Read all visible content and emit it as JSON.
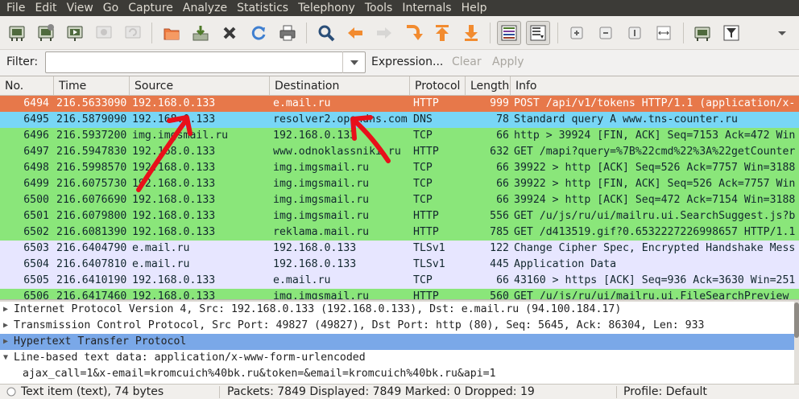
{
  "menu": [
    "File",
    "Edit",
    "View",
    "Go",
    "Capture",
    "Analyze",
    "Statistics",
    "Telephony",
    "Tools",
    "Internals",
    "Help"
  ],
  "toolbar": {
    "icons": [
      "interfaces-icon",
      "options-icon",
      "start-capture-icon",
      "stop-capture-icon",
      "restart-capture-icon",
      "open-file-icon",
      "save-file-icon",
      "close-file-icon",
      "reload-icon",
      "print-icon",
      "find-icon",
      "go-back-icon",
      "go-forward-icon",
      "go-to-packet-icon",
      "go-first-icon",
      "go-last-icon",
      "colorize-icon",
      "autoscroll-icon",
      "zoom-in-icon",
      "zoom-out-icon",
      "normal-size-icon",
      "resize-columns-icon",
      "capture-filters-icon",
      "display-filters-icon",
      "overflow-icon"
    ]
  },
  "filter": {
    "label": "Filter:",
    "value": "",
    "expression": "Expression...",
    "clear": "Clear",
    "apply": "Apply"
  },
  "packet_list": {
    "columns": [
      "No.",
      "Time",
      "Source",
      "Destination",
      "Protocol",
      "Length",
      "Info"
    ],
    "rows": [
      {
        "no": "6494",
        "time": "216.5633090",
        "src": "192.168.0.133",
        "dst": "e.mail.ru",
        "proto": "HTTP",
        "len": "999",
        "info": "POST /api/v1/tokens HTTP/1.1  (application/x-",
        "bg": "#e7784a",
        "fg": "#ffffff"
      },
      {
        "no": "6495",
        "time": "216.5879090",
        "src": "192.168.0.133",
        "dst": "resolver2.opendns.com",
        "proto": "DNS",
        "len": "78",
        "info": "Standard query A www.tns-counter.ru",
        "bg": "#78d6f6",
        "fg": "#12272e"
      },
      {
        "no": "6496",
        "time": "216.5937200",
        "src": "img.imgsmail.ru",
        "dst": "192.168.0.133",
        "proto": "TCP",
        "len": "66",
        "info": "http > 39924 [FIN, ACK] Seq=7153 Ack=472 Win",
        "bg": "#8ae67a",
        "fg": "#12272e"
      },
      {
        "no": "6497",
        "time": "216.5947830",
        "src": "192.168.0.133",
        "dst": "www.odnoklassniki.ru",
        "proto": "HTTP",
        "len": "632",
        "info": "GET /mapi?query=%7B%22cmd%22%3A%22getCounter",
        "bg": "#8ae67a",
        "fg": "#12272e"
      },
      {
        "no": "6498",
        "time": "216.5998570",
        "src": "192.168.0.133",
        "dst": "img.imgsmail.ru",
        "proto": "TCP",
        "len": "66",
        "info": "39922 > http [ACK] Seq=526 Ack=7757 Win=3188",
        "bg": "#8ae67a",
        "fg": "#12272e"
      },
      {
        "no": "6499",
        "time": "216.6075730",
        "src": "192.168.0.133",
        "dst": "img.imgsmail.ru",
        "proto": "TCP",
        "len": "66",
        "info": "39922 > http [FIN, ACK] Seq=526 Ack=7757 Win",
        "bg": "#8ae67a",
        "fg": "#12272e"
      },
      {
        "no": "6500",
        "time": "216.6076690",
        "src": "192.168.0.133",
        "dst": "img.imgsmail.ru",
        "proto": "TCP",
        "len": "66",
        "info": "39924 > http [ACK] Seq=472 Ack=7154 Win=3188",
        "bg": "#8ae67a",
        "fg": "#12272e"
      },
      {
        "no": "6501",
        "time": "216.6079800",
        "src": "192.168.0.133",
        "dst": "img.imgsmail.ru",
        "proto": "HTTP",
        "len": "556",
        "info": "GET /u/js/ru/ui/mailru.ui.SearchSuggest.js?b",
        "bg": "#8ae67a",
        "fg": "#12272e"
      },
      {
        "no": "6502",
        "time": "216.6081390",
        "src": "192.168.0.133",
        "dst": "reklama.mail.ru",
        "proto": "HTTP",
        "len": "785",
        "info": "GET /d413519.gif?0.6532227226998657 HTTP/1.1",
        "bg": "#8ae67a",
        "fg": "#12272e"
      },
      {
        "no": "6503",
        "time": "216.6404790",
        "src": "e.mail.ru",
        "dst": "192.168.0.133",
        "proto": "TLSv1",
        "len": "122",
        "info": "Change Cipher Spec, Encrypted Handshake Mess",
        "bg": "#e7e6ff",
        "fg": "#12272e"
      },
      {
        "no": "6504",
        "time": "216.6407810",
        "src": "e.mail.ru",
        "dst": "192.168.0.133",
        "proto": "TLSv1",
        "len": "445",
        "info": "Application Data",
        "bg": "#e7e6ff",
        "fg": "#12272e"
      },
      {
        "no": "6505",
        "time": "216.6410190",
        "src": "192.168.0.133",
        "dst": "e.mail.ru",
        "proto": "TCP",
        "len": "66",
        "info": "43160 > https [ACK] Seq=936 Ack=3630 Win=251",
        "bg": "#e7e6ff",
        "fg": "#12272e"
      },
      {
        "no": "6506",
        "time": "216.6417460",
        "src": "192.168.0.133",
        "dst": "img.imgsmail.ru",
        "proto": "HTTP",
        "len": "560",
        "info": "GET /u/js/ru/ui/mailru.ui.FileSearchPreview",
        "bg": "#8ae67a",
        "fg": "#12272e"
      }
    ]
  },
  "details": {
    "rows": [
      {
        "arrow": "▶",
        "text": "Internet Protocol Version 4, Src: 192.168.0.133 (192.168.0.133), Dst: e.mail.ru (94.100.184.17)",
        "selected": false
      },
      {
        "arrow": "▶",
        "text": "Transmission Control Protocol, Src Port: 49827 (49827), Dst Port: http (80), Seq: 5645, Ack: 86304, Len: 933",
        "selected": false
      },
      {
        "arrow": "▶",
        "text": "Hypertext Transfer Protocol",
        "selected": true
      },
      {
        "arrow": "▼",
        "text": "Line-based text data: application/x-www-form-urlencoded",
        "selected": false
      },
      {
        "arrow": "",
        "text": "ajax_call=1&x-email=kromcuich%40bk.ru&token=&email=kromcuich%40bk.ru&api=1",
        "selected": false
      }
    ]
  },
  "status": {
    "item": "Text item (text), 74 bytes",
    "packets": "Packets: 7849 Displayed: 7849 Marked: 0 Dropped: 19",
    "profile": "Profile: Default"
  },
  "colors": {
    "menubar": "#3c3b37",
    "selected_detail": "#7aa8e8",
    "annotation_red": "#e8101a"
  }
}
